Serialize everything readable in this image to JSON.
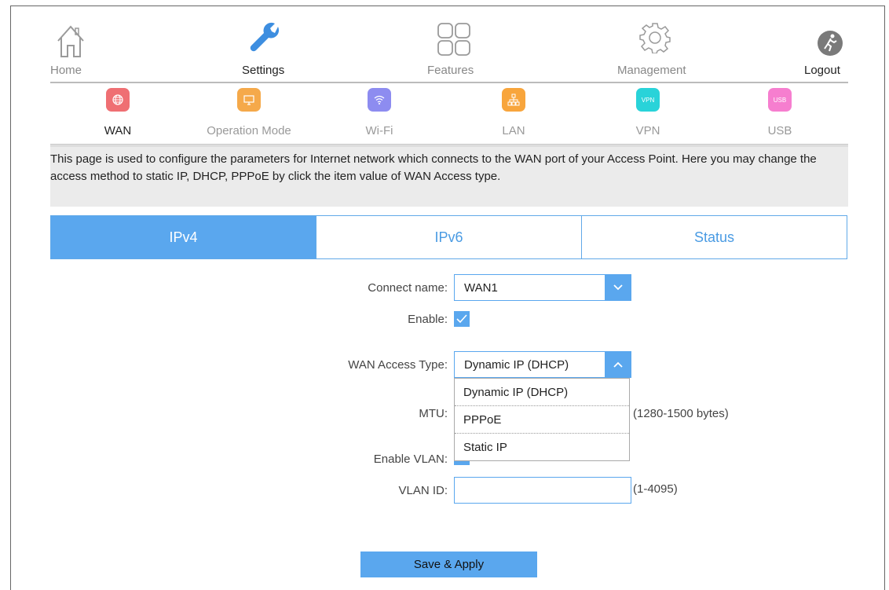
{
  "topnav": {
    "home": "Home",
    "settings": "Settings",
    "features": "Features",
    "management": "Management",
    "logout": "Logout"
  },
  "subnav": [
    {
      "label": "WAN",
      "badge": "",
      "color": "#ef6f73"
    },
    {
      "label": "Operation Mode",
      "badge": "",
      "color": "#f5a94a"
    },
    {
      "label": "Wi-Fi",
      "badge": "",
      "color": "#8d8cf0"
    },
    {
      "label": "LAN",
      "badge": "",
      "color": "#f8a53c"
    },
    {
      "label": "VPN",
      "badge": "VPN",
      "color": "#29d3d9"
    },
    {
      "label": "USB",
      "badge": "USB",
      "color": "#f67ecf"
    }
  ],
  "description": "This page is used to configure the parameters for Internet network which connects to the WAN port of your Access Point. Here you may change the access method to static IP, DHCP, PPPoE by click the item value of WAN Access type.",
  "tabs": [
    "IPv4",
    "IPv6",
    "Status"
  ],
  "form": {
    "connect_name_label": "Connect name:",
    "connect_name_value": "WAN1",
    "enable_label": "Enable:",
    "wan_access_label": "WAN Access Type:",
    "wan_access_value": "Dynamic IP (DHCP)",
    "wan_access_options": [
      "Dynamic IP (DHCP)",
      "PPPoE",
      "Static IP"
    ],
    "mtu_label": "MTU:",
    "mtu_hint": "(1280-1500 bytes)",
    "enable_vlan_label": "Enable VLAN:",
    "vlan_id_label": "VLAN ID:",
    "vlan_id_value": "",
    "vlan_id_hint": "(1-4095)"
  },
  "save_label": "Save & Apply",
  "colors": {
    "accent": "#5aa7ee",
    "gray_bg": "#ebebeb"
  }
}
